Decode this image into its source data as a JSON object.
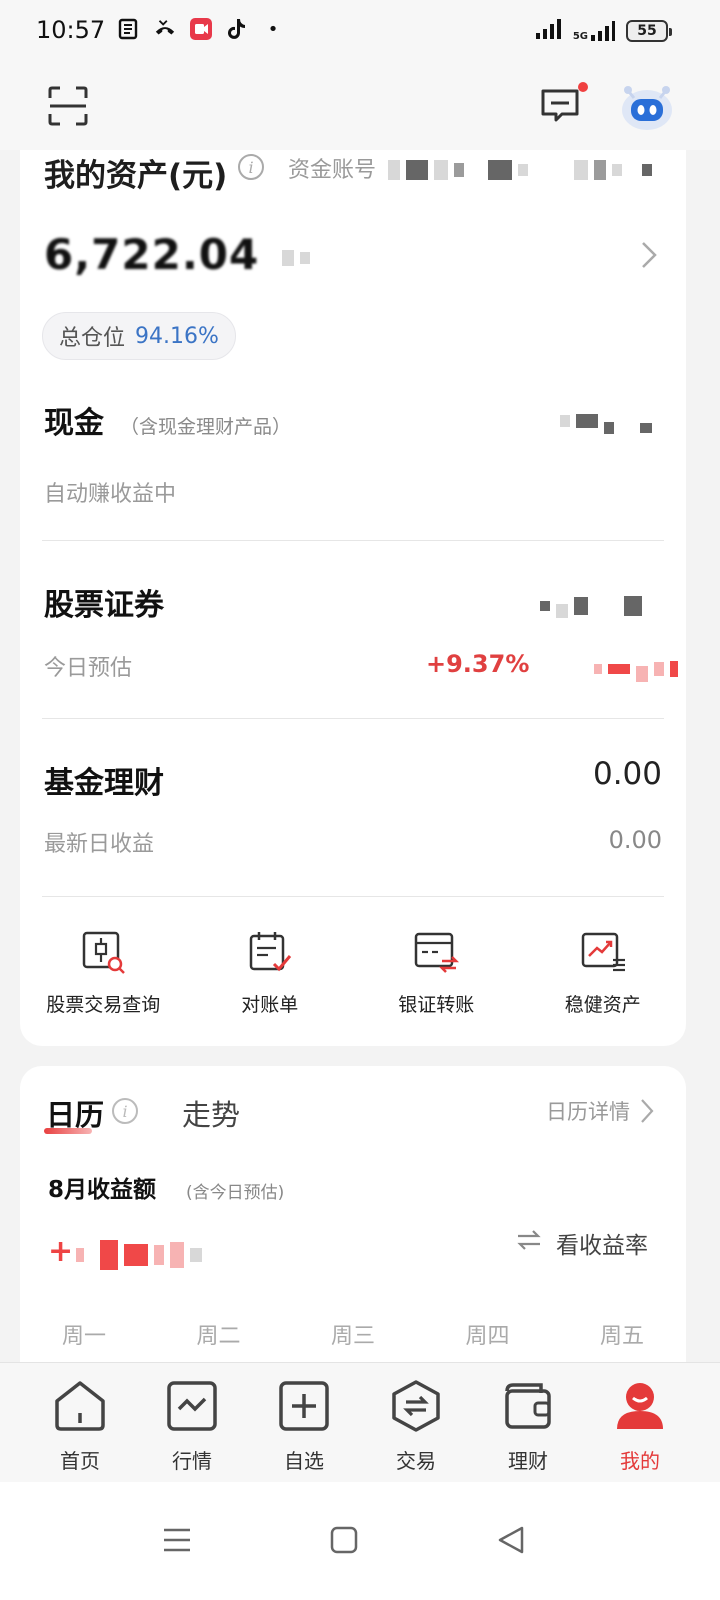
{
  "status_bar": {
    "time": "10:57",
    "network": "5G",
    "battery": "55",
    "dot": "•"
  },
  "header": {
    "icons": [
      "scan-icon",
      "message-icon",
      "robot-assistant-icon"
    ]
  },
  "assets": {
    "title": "我的资产(元)",
    "account_label": "资金账号",
    "total_value": "6,722.04",
    "position_label": "总仓位",
    "position_value": "94.16%"
  },
  "cash": {
    "title": "现金",
    "note": "（含现金理财产品）",
    "sub": "自动赚收益中"
  },
  "stocks": {
    "title": "股票证券",
    "sub": "今日预估",
    "change_pct": "+9.37%"
  },
  "funds": {
    "title": "基金理财",
    "value": "0.00",
    "sub": "最新日收益",
    "sub_value": "0.00"
  },
  "shortcuts": [
    {
      "label": "股票交易查询",
      "icon": "stock-query-icon"
    },
    {
      "label": "对账单",
      "icon": "statement-icon"
    },
    {
      "label": "银证转账",
      "icon": "bank-transfer-icon"
    },
    {
      "label": "稳健资产",
      "icon": "stable-asset-icon"
    }
  ],
  "calendar": {
    "tab_calendar": "日历",
    "tab_trend": "走势",
    "detail_link": "日历详情",
    "month_title": "8月收益额",
    "month_note": "(含今日预估)",
    "income_prefix": "+",
    "toggle_label": "看收益率",
    "weekdays": [
      "周一",
      "周二",
      "周三",
      "周四",
      "周五"
    ]
  },
  "tabbar": [
    {
      "label": "首页",
      "icon": "home-icon"
    },
    {
      "label": "行情",
      "icon": "market-icon"
    },
    {
      "label": "自选",
      "icon": "watchlist-icon"
    },
    {
      "label": "交易",
      "icon": "trade-icon"
    },
    {
      "label": "理财",
      "icon": "wealth-icon"
    },
    {
      "label": "我的",
      "icon": "profile-icon",
      "active": true
    }
  ],
  "colors": {
    "accent_red": "#e43a3a",
    "position_blue": "#3b74c5"
  }
}
